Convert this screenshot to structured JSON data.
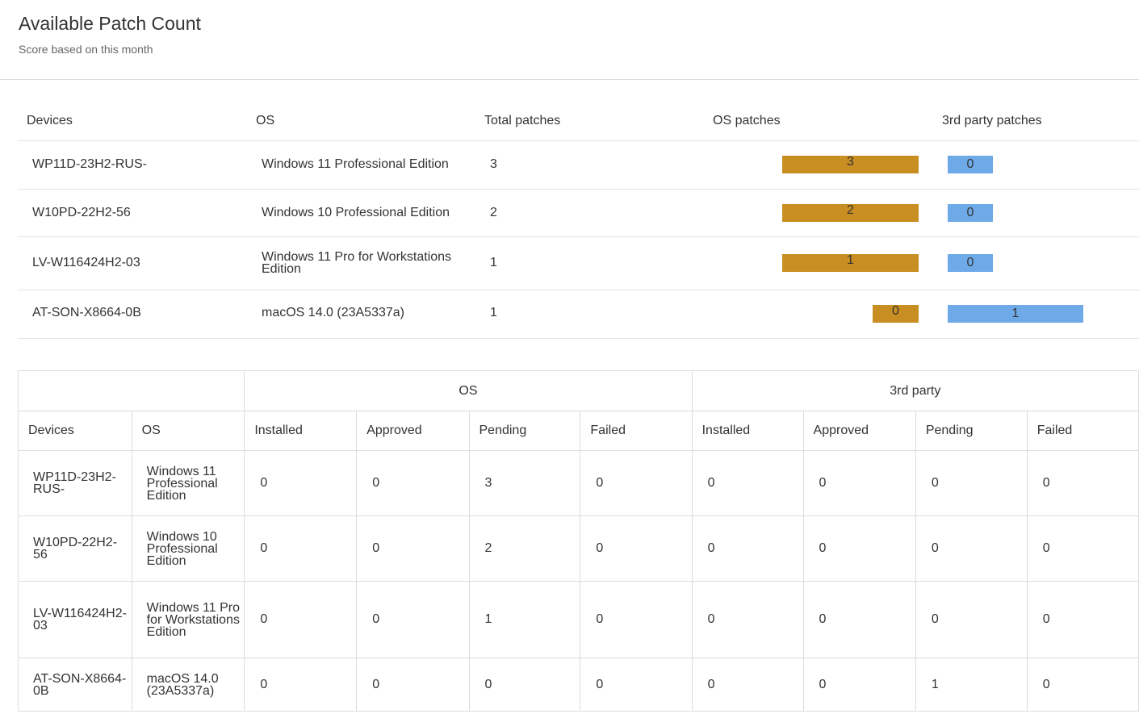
{
  "header": {
    "title": "Available Patch Count",
    "subtitle": "Score based on this month"
  },
  "summary": {
    "columns": {
      "devices": "Devices",
      "os": "OS",
      "total": "Total patches",
      "os_patches": "OS patches",
      "third_party": "3rd party patches"
    },
    "rows": [
      {
        "device": "WP11D-23H2-RUS-",
        "os": "Windows 11 Professional Edition",
        "total": "3",
        "os_patches": "3",
        "third_party": "0"
      },
      {
        "device": "W10PD-22H2-56",
        "os": "Windows 10 Professional Edition",
        "total": "2",
        "os_patches": "2",
        "third_party": "0"
      },
      {
        "device": "LV-W116424H2-03",
        "os": "Windows 11 Pro for Workstations Edition",
        "total": "1",
        "os_patches": "1",
        "third_party": "0"
      },
      {
        "device": "AT-SON-X8664-0B",
        "os": "macOS 14.0 (23A5337a)",
        "total": "1",
        "os_patches": "0",
        "third_party": "1"
      }
    ],
    "colors": {
      "os_bar": "#c98e22",
      "third_party_bar": "#6eaae8"
    }
  },
  "detail": {
    "groups": {
      "os": "OS",
      "third_party": "3rd party"
    },
    "columns": {
      "devices": "Devices",
      "os": "OS",
      "installed": "Installed",
      "approved": "Approved",
      "pending": "Pending",
      "failed": "Failed"
    },
    "rows": [
      {
        "device": "WP11D-23H2-RUS-",
        "os": "Windows 11 Professional Edition",
        "values": [
          "0",
          "0",
          "3",
          "0",
          "0",
          "0",
          "0",
          "0"
        ]
      },
      {
        "device": "W10PD-22H2-56",
        "os": "Windows 10 Professional Edition",
        "values": [
          "0",
          "0",
          "2",
          "0",
          "0",
          "0",
          "0",
          "0"
        ]
      },
      {
        "device": "LV-W116424H2-03",
        "os": "Windows 11 Pro for Workstations Edition",
        "values": [
          "0",
          "0",
          "1",
          "0",
          "0",
          "0",
          "0",
          "0"
        ]
      },
      {
        "device": "AT-SON-X8664-0B",
        "os": "macOS 14.0 (23A5337a)",
        "values": [
          "0",
          "0",
          "0",
          "0",
          "0",
          "0",
          "1",
          "0"
        ]
      }
    ]
  }
}
